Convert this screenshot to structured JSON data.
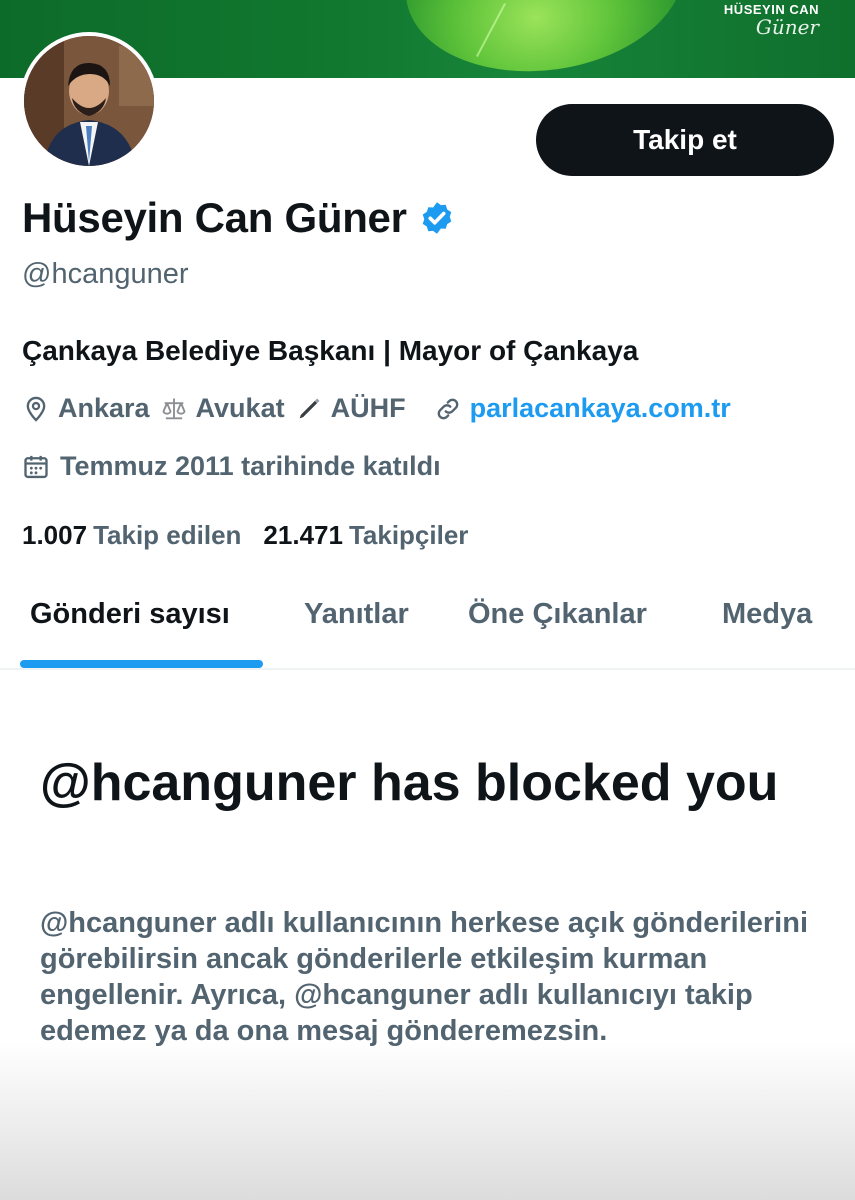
{
  "banner": {
    "brand_line1": "HÜSEYIN CAN",
    "brand_line2": "Güner"
  },
  "profile": {
    "follow_label": "Takip et",
    "name": "Hüseyin Can Güner",
    "handle": "@hcanguner",
    "bio": "Çankaya Belediye Başkanı | Mayor of Çankaya",
    "location": "Ankara",
    "job1": "Avukat",
    "job2": "AÜHF",
    "website": "parlacankaya.com.tr",
    "joined": "Temmuz 2011 tarihinde katıldı",
    "following_count": "1.007",
    "following_label": "Takip edilen",
    "followers_count": "21.471",
    "followers_label": "Takipçiler"
  },
  "tabs": [
    {
      "label": "Gönderi sayısı"
    },
    {
      "label": "Yanıtlar"
    },
    {
      "label": "Öne Çıkanlar"
    },
    {
      "label": "Medya"
    }
  ],
  "blocked": {
    "title": "@hcanguner has blocked you",
    "description": "@hcanguner adlı kullanıcının herkese açık gönderilerini görebilirsin ancak gönderilerle etkileşim kurman engellenir. Ayrıca, @hcanguner adlı kullanıcıyı takip edemez ya da ona mesaj gönderemezsin."
  },
  "colors": {
    "accent": "#1d9bf0",
    "text": "#0f1419",
    "muted": "#536471",
    "banner": "#11782f"
  }
}
